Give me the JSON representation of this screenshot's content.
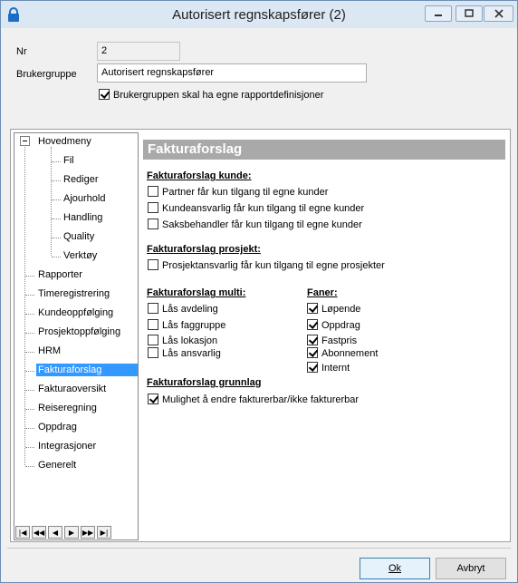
{
  "window": {
    "title": "Autorisert regnskapsfører (2)"
  },
  "form": {
    "nr_label": "Nr",
    "nr_value": "2",
    "group_label": "Brukergruppe",
    "group_value": "Autorisert regnskapsfører",
    "own_reports_label": "Brukergruppen skal ha egne rapportdefinisjoner",
    "own_reports_checked": true
  },
  "tree": {
    "root": "Hovedmeny",
    "children": [
      "Fil",
      "Rediger",
      "Ajourhold",
      "Handling",
      "Quality",
      "Verktøy"
    ],
    "items": [
      "Rapporter",
      "Timeregistrering",
      "Kundeoppfølging",
      "Prosjektoppfølging",
      "HRM",
      "Fakturaforslag",
      "Fakturaoversikt",
      "Reiseregning",
      "Oppdrag",
      "Integrasjoner",
      "Generelt"
    ],
    "selected": "Fakturaforslag",
    "nav": [
      "first",
      "prev-page",
      "prev",
      "next",
      "next-page",
      "last"
    ]
  },
  "content": {
    "header": "Fakturaforslag",
    "kunde": {
      "title": "Fakturaforslag kunde:",
      "options": [
        {
          "label": "Partner får kun tilgang til egne kunder",
          "checked": false
        },
        {
          "label": "Kundeansvarlig får kun tilgang til egne kunder",
          "checked": false
        },
        {
          "label": "Saksbehandler får kun tilgang til egne kunder",
          "checked": false
        }
      ]
    },
    "prosjekt": {
      "title": "Fakturaforslag prosjekt:",
      "options": [
        {
          "label": "Prosjektansvarlig får kun tilgang til egne prosjekter",
          "checked": false
        }
      ]
    },
    "multi": {
      "title": "Fakturaforslag multi:",
      "options": [
        {
          "label": "Lås avdeling",
          "checked": false
        },
        {
          "label": "Lås faggruppe",
          "checked": false
        },
        {
          "label": "Lås lokasjon",
          "checked": false
        },
        {
          "label": "Lås ansvarlig",
          "checked": false
        }
      ]
    },
    "faner": {
      "title": "Faner:",
      "options": [
        {
          "label": "Løpende",
          "checked": true
        },
        {
          "label": "Oppdrag",
          "checked": true
        },
        {
          "label": "Fastpris",
          "checked": true
        },
        {
          "label": "Abonnement",
          "checked": true
        },
        {
          "label": "Internt",
          "checked": true
        }
      ]
    },
    "grunnlag": {
      "title": "Fakturaforslag grunnlag",
      "options": [
        {
          "label": "Mulighet å endre fakturerbar/ikke fakturerbar",
          "checked": true
        }
      ]
    }
  },
  "buttons": {
    "ok": "Ok",
    "cancel": "Avbryt"
  }
}
